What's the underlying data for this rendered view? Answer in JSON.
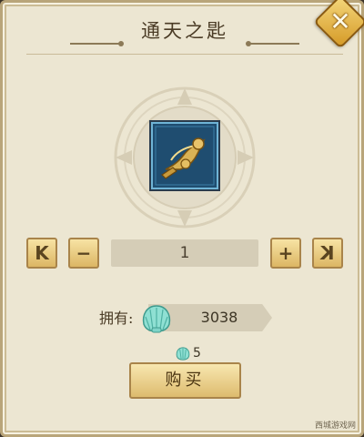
{
  "dialog": {
    "title": "通天之匙",
    "close_label": "✕"
  },
  "item": {
    "icon": "golden-horn-key-icon",
    "frame_color": "#1e4a6c"
  },
  "quantity": {
    "first_label": "K",
    "minus_label": "−",
    "value": "1",
    "plus_label": "+",
    "last_label": "K"
  },
  "owned": {
    "label": "拥有:",
    "currency_icon": "shell-icon",
    "amount": "3038"
  },
  "price": {
    "currency_icon": "shell-icon",
    "amount": "5"
  },
  "buy_label": "购买",
  "watermark": "西城游戏网",
  "colors": {
    "panel": "#ece6d2",
    "button_gold": "#dcb664",
    "accent_close": "#d59a27",
    "shell": "#7fd4c8"
  }
}
